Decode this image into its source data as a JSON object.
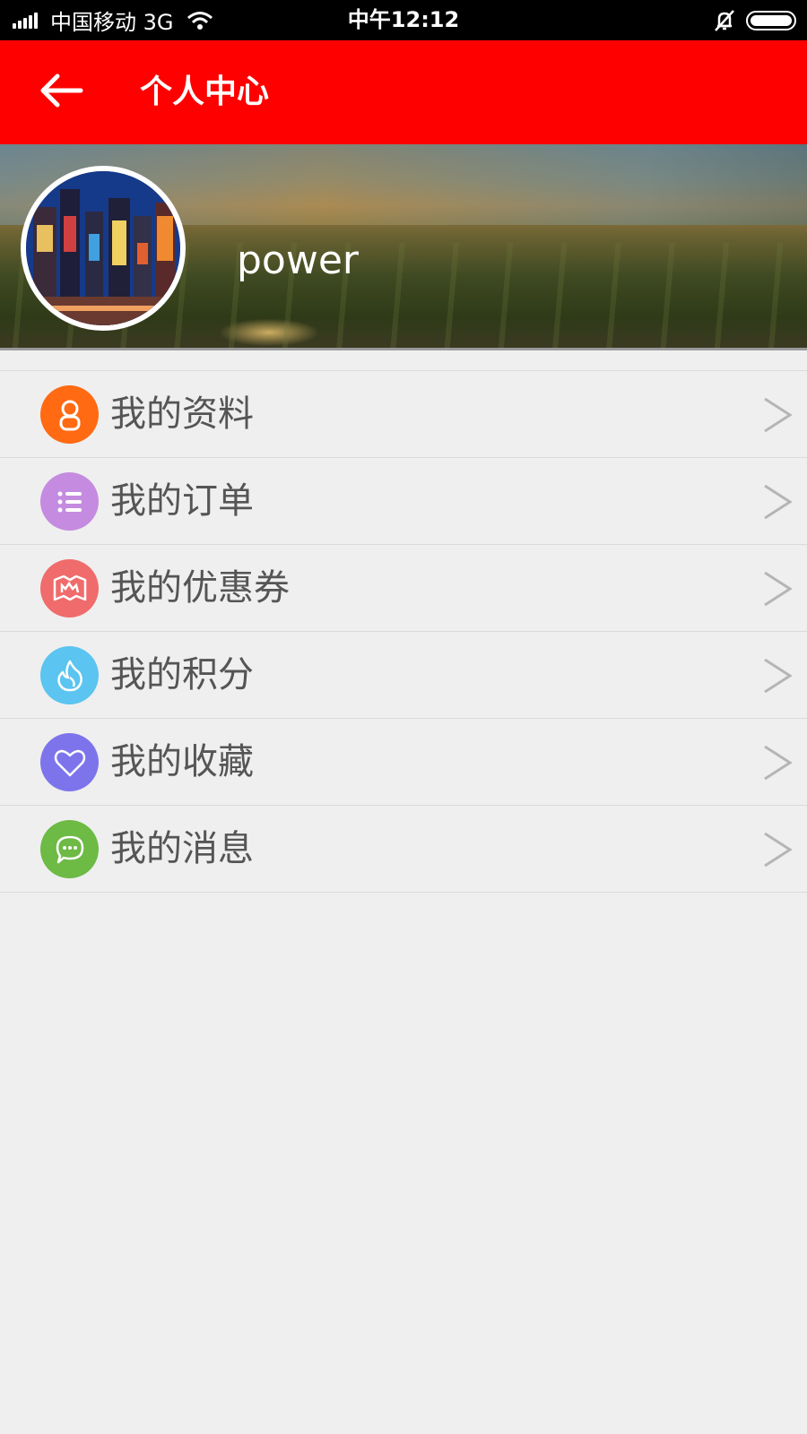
{
  "status_bar": {
    "carrier": "中国移动 3G",
    "time": "中午12:12"
  },
  "header": {
    "title": "个人中心",
    "back_icon": "arrow-left-icon"
  },
  "profile": {
    "username": "power"
  },
  "menu": [
    {
      "label": "我的资料",
      "icon": "user-icon",
      "color": "#ff6a12"
    },
    {
      "label": "我的订单",
      "icon": "list-icon",
      "color": "#c48be0"
    },
    {
      "label": "我的优惠券",
      "icon": "coupon-map-icon",
      "color": "#f06b6b"
    },
    {
      "label": "我的积分",
      "icon": "flame-icon",
      "color": "#5bc4f0"
    },
    {
      "label": "我的收藏",
      "icon": "heart-icon",
      "color": "#7d74ec"
    },
    {
      "label": "我的消息",
      "icon": "chat-bubble-icon",
      "color": "#6dba45"
    }
  ],
  "colors": {
    "header_bg": "#ff0000",
    "page_bg": "#efefef"
  }
}
